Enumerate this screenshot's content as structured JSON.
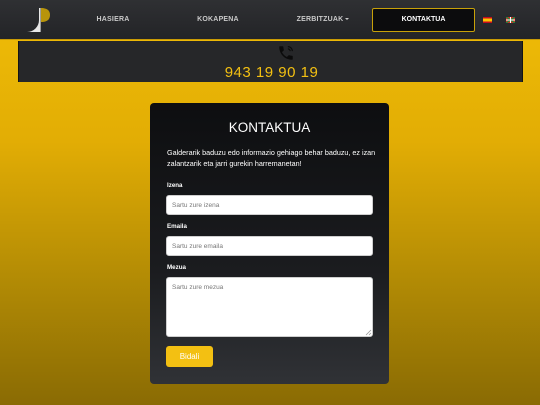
{
  "nav": {
    "items": [
      {
        "label": "HASIERA"
      },
      {
        "label": "KOKAPENA"
      },
      {
        "label": "ZERBITZUAK"
      },
      {
        "label": "KONTAKTUA"
      }
    ],
    "languages": [
      "es",
      "eu"
    ]
  },
  "phone": {
    "icon": "phone-icon",
    "number": "943 19 90 19"
  },
  "contact": {
    "title": "KONTAKTUA",
    "description": "Galderarik baduzu edo informazio gehiago behar baduzu, ez izan zalantzarik eta jarri gurekin harremanetan!",
    "name_label": "Izena",
    "name_placeholder": "Sartu zure izena",
    "email_label": "Emaila",
    "email_placeholder": "Sartu zure emaila",
    "message_label": "Mezua",
    "message_placeholder": "Sartu zure mezua",
    "submit_label": "Bidali"
  },
  "colors": {
    "accent": "#f3c012",
    "navbar": "#2a2b2e",
    "card": "#121315"
  }
}
